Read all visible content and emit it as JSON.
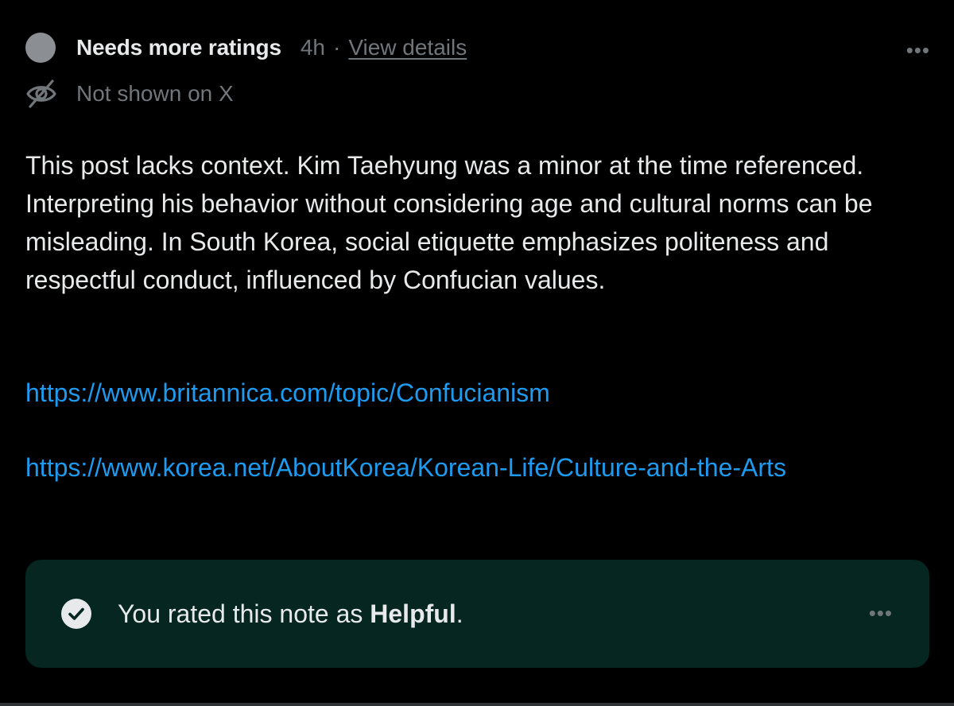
{
  "note": {
    "status": "Needs more ratings",
    "time": "4h",
    "separator": "·",
    "view_details": "View details",
    "visibility": "Not shown on X",
    "body": "This post lacks context. Kim Taehyung was a minor at the time referenced. Interpreting his behavior without considering age and cultural norms can be misleading. In South Korea, social etiquette emphasizes politeness and respectful conduct, influenced by Confucian values.",
    "links": [
      "https://www.britannica.com/topic/Confucianism",
      "https://www.korea.net/AboutKorea/Korean-Life/Culture-and-the-Arts"
    ],
    "more_menu": "•••"
  },
  "rating": {
    "prefix": "You rated this note as ",
    "value": "Helpful",
    "suffix": ".",
    "more_menu": "•••"
  },
  "icons": {
    "status": "status-dot-icon",
    "visibility": "eye-off-icon",
    "rating": "check-circle-icon"
  },
  "colors": {
    "background": "#000000",
    "text": "#e7e9ea",
    "muted": "#71767b",
    "link": "#1d9bf0",
    "panel": "#052621"
  }
}
